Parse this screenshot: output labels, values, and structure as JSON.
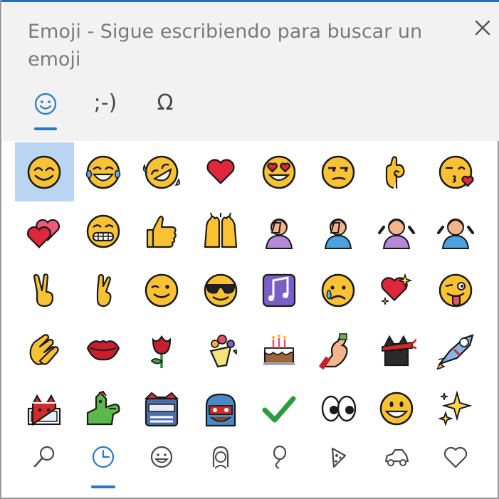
{
  "window": {
    "title": "Emoji - Sigue escribiendo para buscar un emoji",
    "close_glyph": "✕"
  },
  "category_tabs": [
    {
      "name": "emoji",
      "glyph": "☺",
      "selected": true
    },
    {
      "name": "kaomoji",
      "glyph": ";-)",
      "selected": false
    },
    {
      "name": "symbols",
      "glyph": "Ω",
      "selected": false
    }
  ],
  "emoji_grid": [
    "smiling-face-with-smiling-eyes",
    "face-with-tears-of-joy",
    "rolling-on-the-floor-laughing",
    "red-heart",
    "smiling-face-with-heart-eyes",
    "unamused-face",
    "ok-hand",
    "face-blowing-a-kiss",
    "two-hearts",
    "beaming-face-with-smiling-eyes",
    "thumbs-up",
    "raising-hands",
    "woman-facepalming",
    "man-facepalming",
    "woman-shrugging",
    "man-shrugging",
    "victory-hand",
    "crossed-fingers",
    "winking-face",
    "smiling-face-with-sunglasses",
    "musical-notes",
    "crying-face",
    "sparkling-heart",
    "winking-face-with-tongue",
    "clapping-hands",
    "kiss-mark",
    "rose",
    "bouquet",
    "birthday-cake",
    "flexed-biceps",
    "ninja-cat",
    "astro-cat",
    "hacker-cat",
    "dino-cat",
    "stunt-cat",
    "hipster-cat",
    "check-mark",
    "eyes",
    "grinning-face",
    "sparkles"
  ],
  "selected_emoji": "smiling-face-with-smiling-eyes",
  "bottom_nav": [
    {
      "name": "search",
      "selected": false
    },
    {
      "name": "recent",
      "selected": true
    },
    {
      "name": "smileys",
      "selected": false
    },
    {
      "name": "people",
      "selected": false
    },
    {
      "name": "celebrations",
      "selected": false
    },
    {
      "name": "food",
      "selected": false
    },
    {
      "name": "travel",
      "selected": false
    },
    {
      "name": "symbols-heart",
      "selected": false
    }
  ],
  "colors": {
    "header_bg": "#f2f2f2",
    "accent": "#2978c7",
    "selection": "#b9d5f1",
    "title_text": "#7a7a7a",
    "emoji_yellow": "#f9c233",
    "emoji_outline": "#1a1a1a",
    "heart_red": "#e0263a"
  }
}
